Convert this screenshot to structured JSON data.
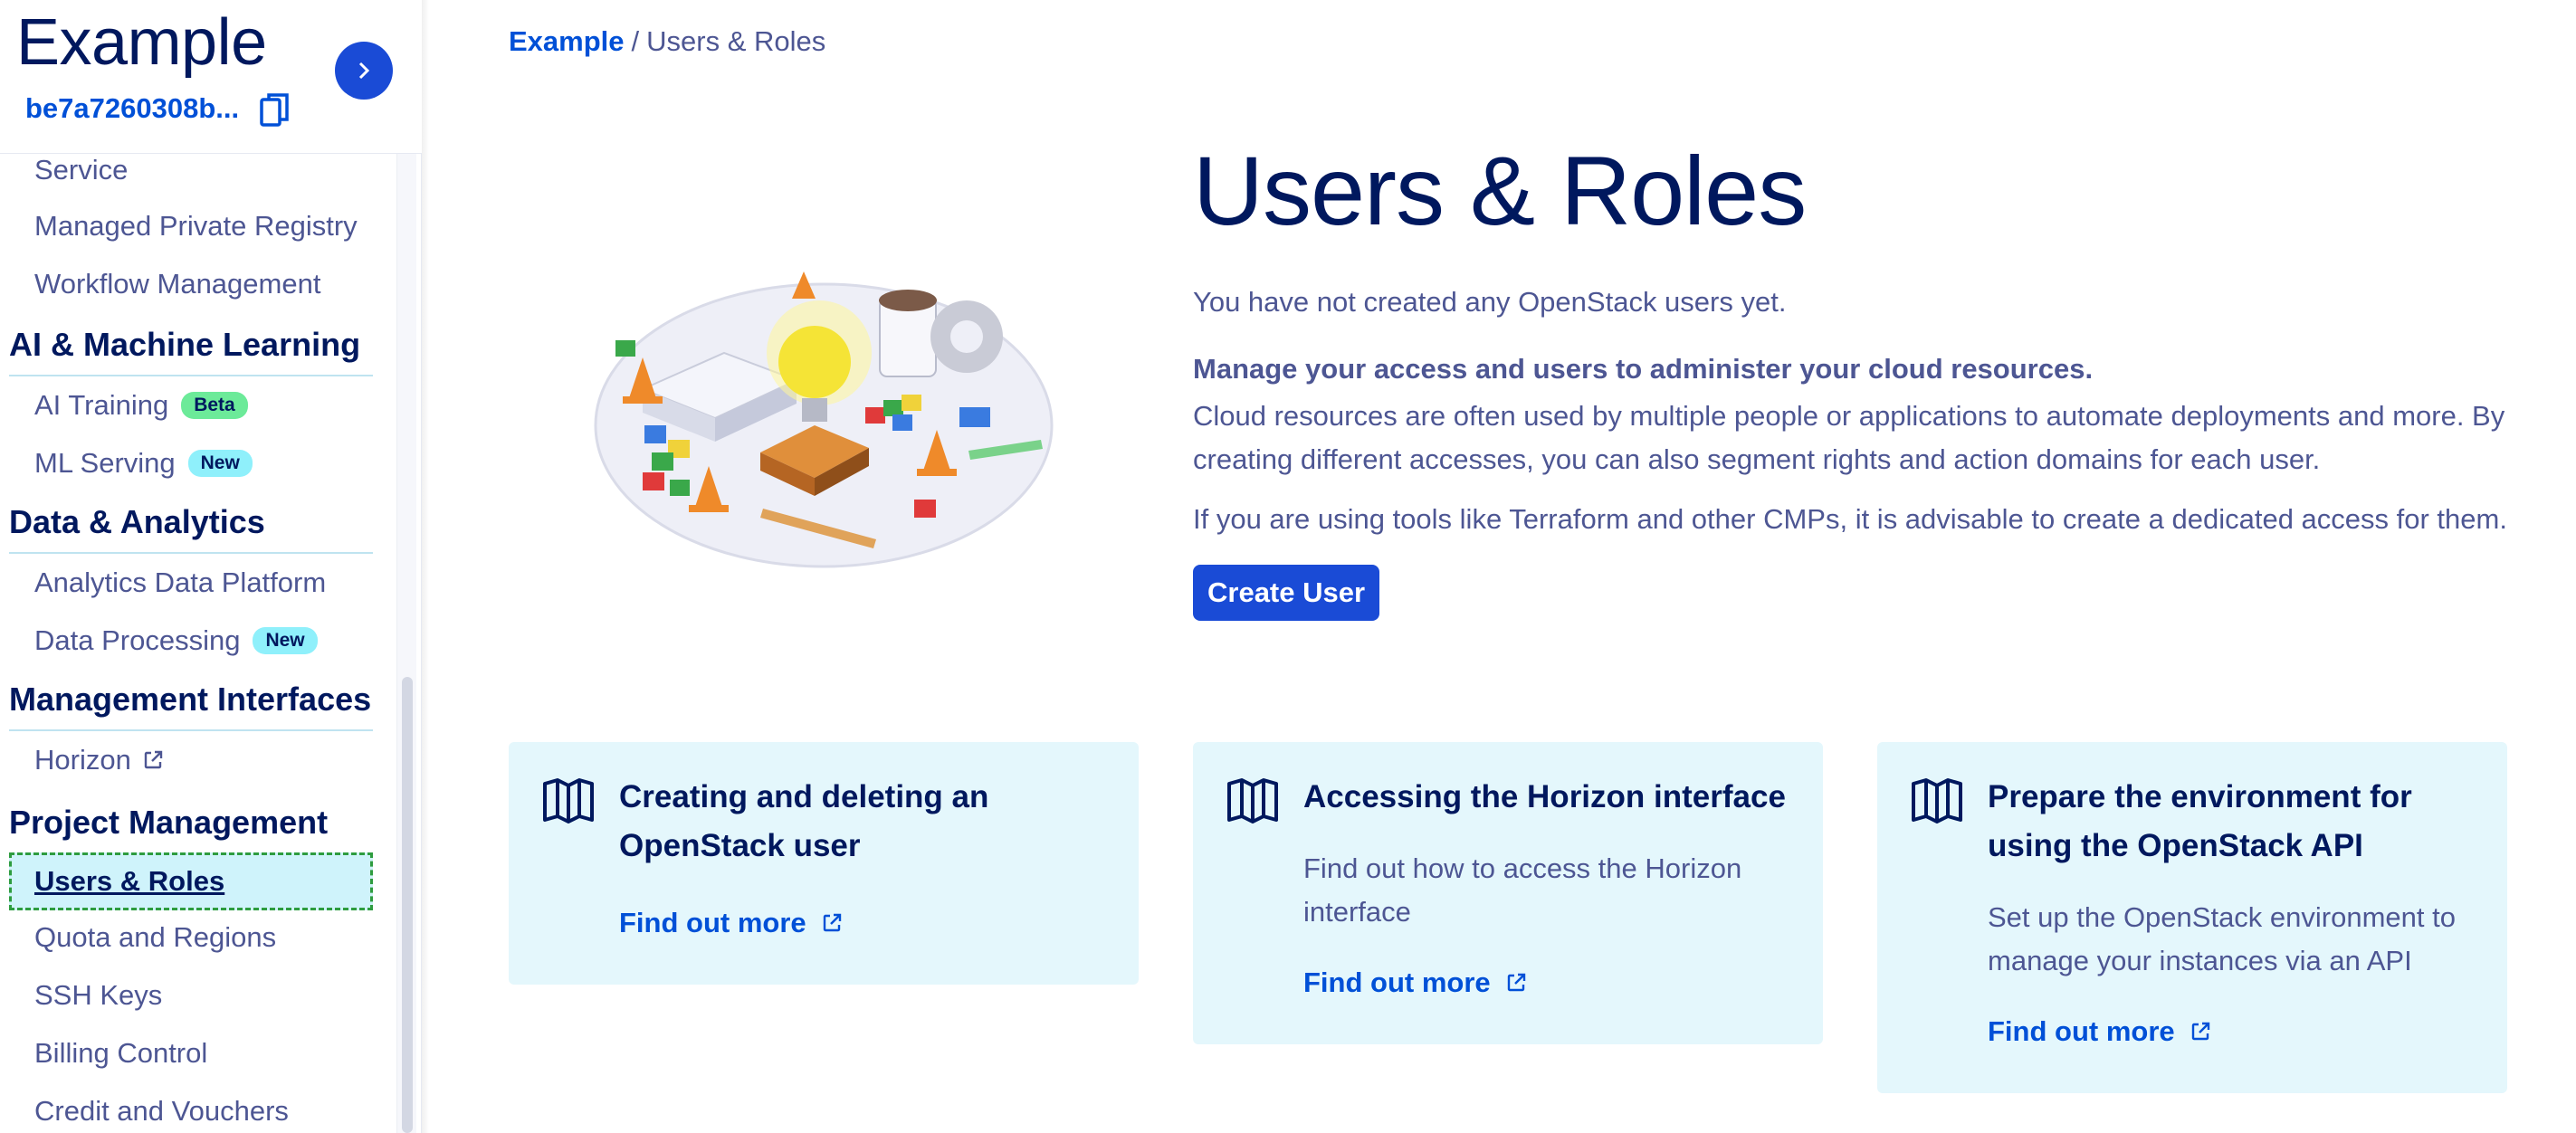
{
  "sidebar": {
    "project_name": "Example",
    "project_id": "be7a7260308b...",
    "items_top": [
      {
        "label": "Service"
      },
      {
        "label": "Managed Private Registry"
      },
      {
        "label": "Workflow Management"
      }
    ],
    "sections": [
      {
        "title": "AI & Machine Learning",
        "items": [
          {
            "label": "AI Training",
            "badge": "Beta"
          },
          {
            "label": "ML Serving",
            "badge": "New"
          }
        ]
      },
      {
        "title": "Data & Analytics",
        "items": [
          {
            "label": "Analytics Data Platform"
          },
          {
            "label": "Data Processing",
            "badge": "New"
          }
        ]
      },
      {
        "title": "Management Interfaces",
        "items": [
          {
            "label": "Horizon",
            "external": true
          }
        ]
      },
      {
        "title": "Project Management",
        "items": [
          {
            "label": "Users & Roles",
            "active": true
          },
          {
            "label": "Quota and Regions"
          },
          {
            "label": "SSH Keys"
          },
          {
            "label": "Billing Control"
          },
          {
            "label": "Credit and Vouchers"
          }
        ]
      }
    ]
  },
  "breadcrumb": {
    "root": "Example",
    "separator": "/",
    "current": "Users & Roles"
  },
  "main": {
    "title": "Users & Roles",
    "intro": "You have not created any OpenStack users yet.",
    "desc_bold": "Manage your access and users to administer your cloud resources.",
    "desc": "Cloud resources are often used by multiple people or applications to automate deployments and more. By creating different accesses, you can also segment rights and action domains for each user.",
    "desc2": "If you are using tools like Terraform and other CMPs, it is advisable to create a dedicated access for them.",
    "create_button": "Create User"
  },
  "cards": [
    {
      "title": "Creating and deleting an OpenStack user",
      "text": "",
      "link": "Find out more"
    },
    {
      "title": "Accessing the Horizon interface",
      "text": "Find out how to access the Horizon interface",
      "link": "Find out more"
    },
    {
      "title": "Prepare the environment for using the OpenStack API",
      "text": "Set up the OpenStack environment to manage your instances via an API",
      "link": "Find out more"
    }
  ],
  "colors": {
    "primary": "#1a4bd6",
    "link": "#0050d7",
    "heading": "#00185e",
    "text": "#4d5693",
    "card_bg": "#e4f7fc",
    "badge_beta": "#6cea99",
    "badge_new": "#8ff0fb"
  },
  "icons": [
    "copy-icon",
    "chevron-right-icon",
    "external-link-icon",
    "book-icon"
  ]
}
